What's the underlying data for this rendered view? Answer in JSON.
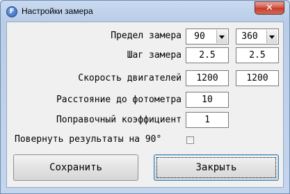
{
  "window": {
    "title": "Настройки замера",
    "app_icon": "app-f-icon",
    "close_symbol": "✕"
  },
  "form": {
    "range": {
      "label": "Предел замера",
      "combo1_value": "90",
      "combo2_value": "360"
    },
    "step": {
      "label": "Шаг замера",
      "value1": "2.5",
      "value2": "2.5"
    },
    "speed": {
      "label": "Скорость двигателей",
      "value1": "1200",
      "value2": "1200"
    },
    "distance": {
      "label": "Расстояние до фотометра",
      "value": "10"
    },
    "correction": {
      "label": "Поправочный коэффициент",
      "value": "1"
    },
    "rotate": {
      "label": "Повернуть результаты на 90°",
      "checked": false
    }
  },
  "buttons": {
    "save": "Сохранить",
    "close": "Закрыть"
  },
  "colors": {
    "close_button": "#c94a3a",
    "focus_border": "#3c7fb1"
  }
}
